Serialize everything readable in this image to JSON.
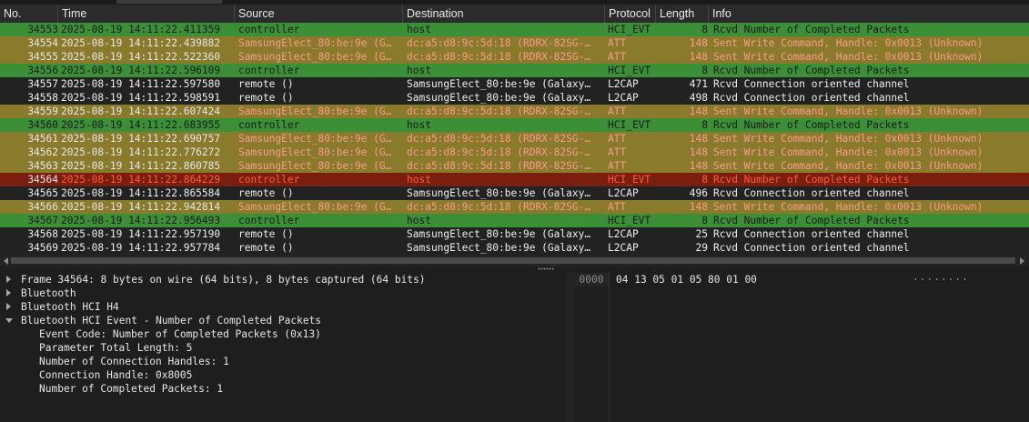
{
  "columns": [
    "No.",
    "Time",
    "Source",
    "Destination",
    "Protocol",
    "Length",
    "Info"
  ],
  "packets": [
    {
      "no": "34553",
      "time": "2025-08-19 14:11:22.411359",
      "src": "controller",
      "dst": "host",
      "proto": "HCI_EVT",
      "len": "8",
      "info": "Rcvd Number of Completed Packets",
      "type": "evt"
    },
    {
      "no": "34554",
      "time": "2025-08-19 14:11:22.439882",
      "src": "SamsungElect_80:be:9e (G…",
      "dst": "dc:a5:d8:9c:5d:18 (RDRX-82SG-…",
      "proto": "ATT",
      "len": "148",
      "info": "Sent Write Command, Handle: 0x0013 (Unknown)",
      "type": "att"
    },
    {
      "no": "34555",
      "time": "2025-08-19 14:11:22.522360",
      "src": "SamsungElect_80:be:9e (G…",
      "dst": "dc:a5:d8:9c:5d:18 (RDRX-82SG-…",
      "proto": "ATT",
      "len": "148",
      "info": "Sent Write Command, Handle: 0x0013 (Unknown)",
      "type": "att"
    },
    {
      "no": "34556",
      "time": "2025-08-19 14:11:22.596109",
      "src": "controller",
      "dst": "host",
      "proto": "HCI_EVT",
      "len": "8",
      "info": "Rcvd Number of Completed Packets",
      "type": "evt"
    },
    {
      "no": "34557",
      "time": "2025-08-19 14:11:22.597580",
      "src": "remote ()",
      "dst": "SamsungElect_80:be:9e (Galaxy…",
      "proto": "L2CAP",
      "len": "471",
      "info": "Rcvd Connection oriented channel",
      "type": "l2"
    },
    {
      "no": "34558",
      "time": "2025-08-19 14:11:22.598591",
      "src": "remote ()",
      "dst": "SamsungElect_80:be:9e (Galaxy…",
      "proto": "L2CAP",
      "len": "498",
      "info": "Rcvd Connection oriented channel",
      "type": "l2"
    },
    {
      "no": "34559",
      "time": "2025-08-19 14:11:22.607424",
      "src": "SamsungElect_80:be:9e (G…",
      "dst": "dc:a5:d8:9c:5d:18 (RDRX-82SG-…",
      "proto": "ATT",
      "len": "148",
      "info": "Sent Write Command, Handle: 0x0013 (Unknown)",
      "type": "att"
    },
    {
      "no": "34560",
      "time": "2025-08-19 14:11:22.683955",
      "src": "controller",
      "dst": "host",
      "proto": "HCI_EVT",
      "len": "8",
      "info": "Rcvd Number of Completed Packets",
      "type": "evt"
    },
    {
      "no": "34561",
      "time": "2025-08-19 14:11:22.690757",
      "src": "SamsungElect_80:be:9e (G…",
      "dst": "dc:a5:d8:9c:5d:18 (RDRX-82SG-…",
      "proto": "ATT",
      "len": "148",
      "info": "Sent Write Command, Handle: 0x0013 (Unknown)",
      "type": "att"
    },
    {
      "no": "34562",
      "time": "2025-08-19 14:11:22.776272",
      "src": "SamsungElect_80:be:9e (G…",
      "dst": "dc:a5:d8:9c:5d:18 (RDRX-82SG-…",
      "proto": "ATT",
      "len": "148",
      "info": "Sent Write Command, Handle: 0x0013 (Unknown)",
      "type": "att"
    },
    {
      "no": "34563",
      "time": "2025-08-19 14:11:22.860785",
      "src": "SamsungElect_80:be:9e (G…",
      "dst": "dc:a5:d8:9c:5d:18 (RDRX-82SG-…",
      "proto": "ATT",
      "len": "148",
      "info": "Sent Write Command, Handle: 0x0013 (Unknown)",
      "type": "att"
    },
    {
      "no": "34564",
      "time": "2025-08-19 14:11:22.864229",
      "src": "controller",
      "dst": "host",
      "proto": "HCI_EVT",
      "len": "8",
      "info": "Rcvd Number of Completed Packets",
      "type": "sel"
    },
    {
      "no": "34565",
      "time": "2025-08-19 14:11:22.865584",
      "src": "remote ()",
      "dst": "SamsungElect_80:be:9e (Galaxy…",
      "proto": "L2CAP",
      "len": "496",
      "info": "Rcvd Connection oriented channel",
      "type": "l2"
    },
    {
      "no": "34566",
      "time": "2025-08-19 14:11:22.942814",
      "src": "SamsungElect_80:be:9e (G…",
      "dst": "dc:a5:d8:9c:5d:18 (RDRX-82SG-…",
      "proto": "ATT",
      "len": "148",
      "info": "Sent Write Command, Handle: 0x0013 (Unknown)",
      "type": "att"
    },
    {
      "no": "34567",
      "time": "2025-08-19 14:11:22.956493",
      "src": "controller",
      "dst": "host",
      "proto": "HCI_EVT",
      "len": "8",
      "info": "Rcvd Number of Completed Packets",
      "type": "evt"
    },
    {
      "no": "34568",
      "time": "2025-08-19 14:11:22.957190",
      "src": "remote ()",
      "dst": "SamsungElect_80:be:9e (Galaxy…",
      "proto": "L2CAP",
      "len": "25",
      "info": "Rcvd Connection oriented channel",
      "type": "l2"
    },
    {
      "no": "34569",
      "time": "2025-08-19 14:11:22.957784",
      "src": "remote ()",
      "dst": "SamsungElect_80:be:9e (Galaxy…",
      "proto": "L2CAP",
      "len": "29",
      "info": "Rcvd Connection oriented channel",
      "type": "l2"
    }
  ],
  "details": {
    "frame": "Frame 34564: 8 bytes on wire (64 bits), 8 bytes captured (64 bits)",
    "bluetooth": "Bluetooth",
    "hci_h4": "Bluetooth HCI H4",
    "hci_event": "Bluetooth HCI Event - Number of Completed Packets",
    "children": [
      "Event Code: Number of Completed Packets (0x13)",
      "Parameter Total Length: 5",
      "Number of Connection Handles: 1",
      "Connection Handle: 0x8005",
      "Number of Completed Packets: 1"
    ]
  },
  "hex": {
    "offset": "0000",
    "bytes": "04 13 05 01 05 80 01 00",
    "ascii": "········"
  }
}
